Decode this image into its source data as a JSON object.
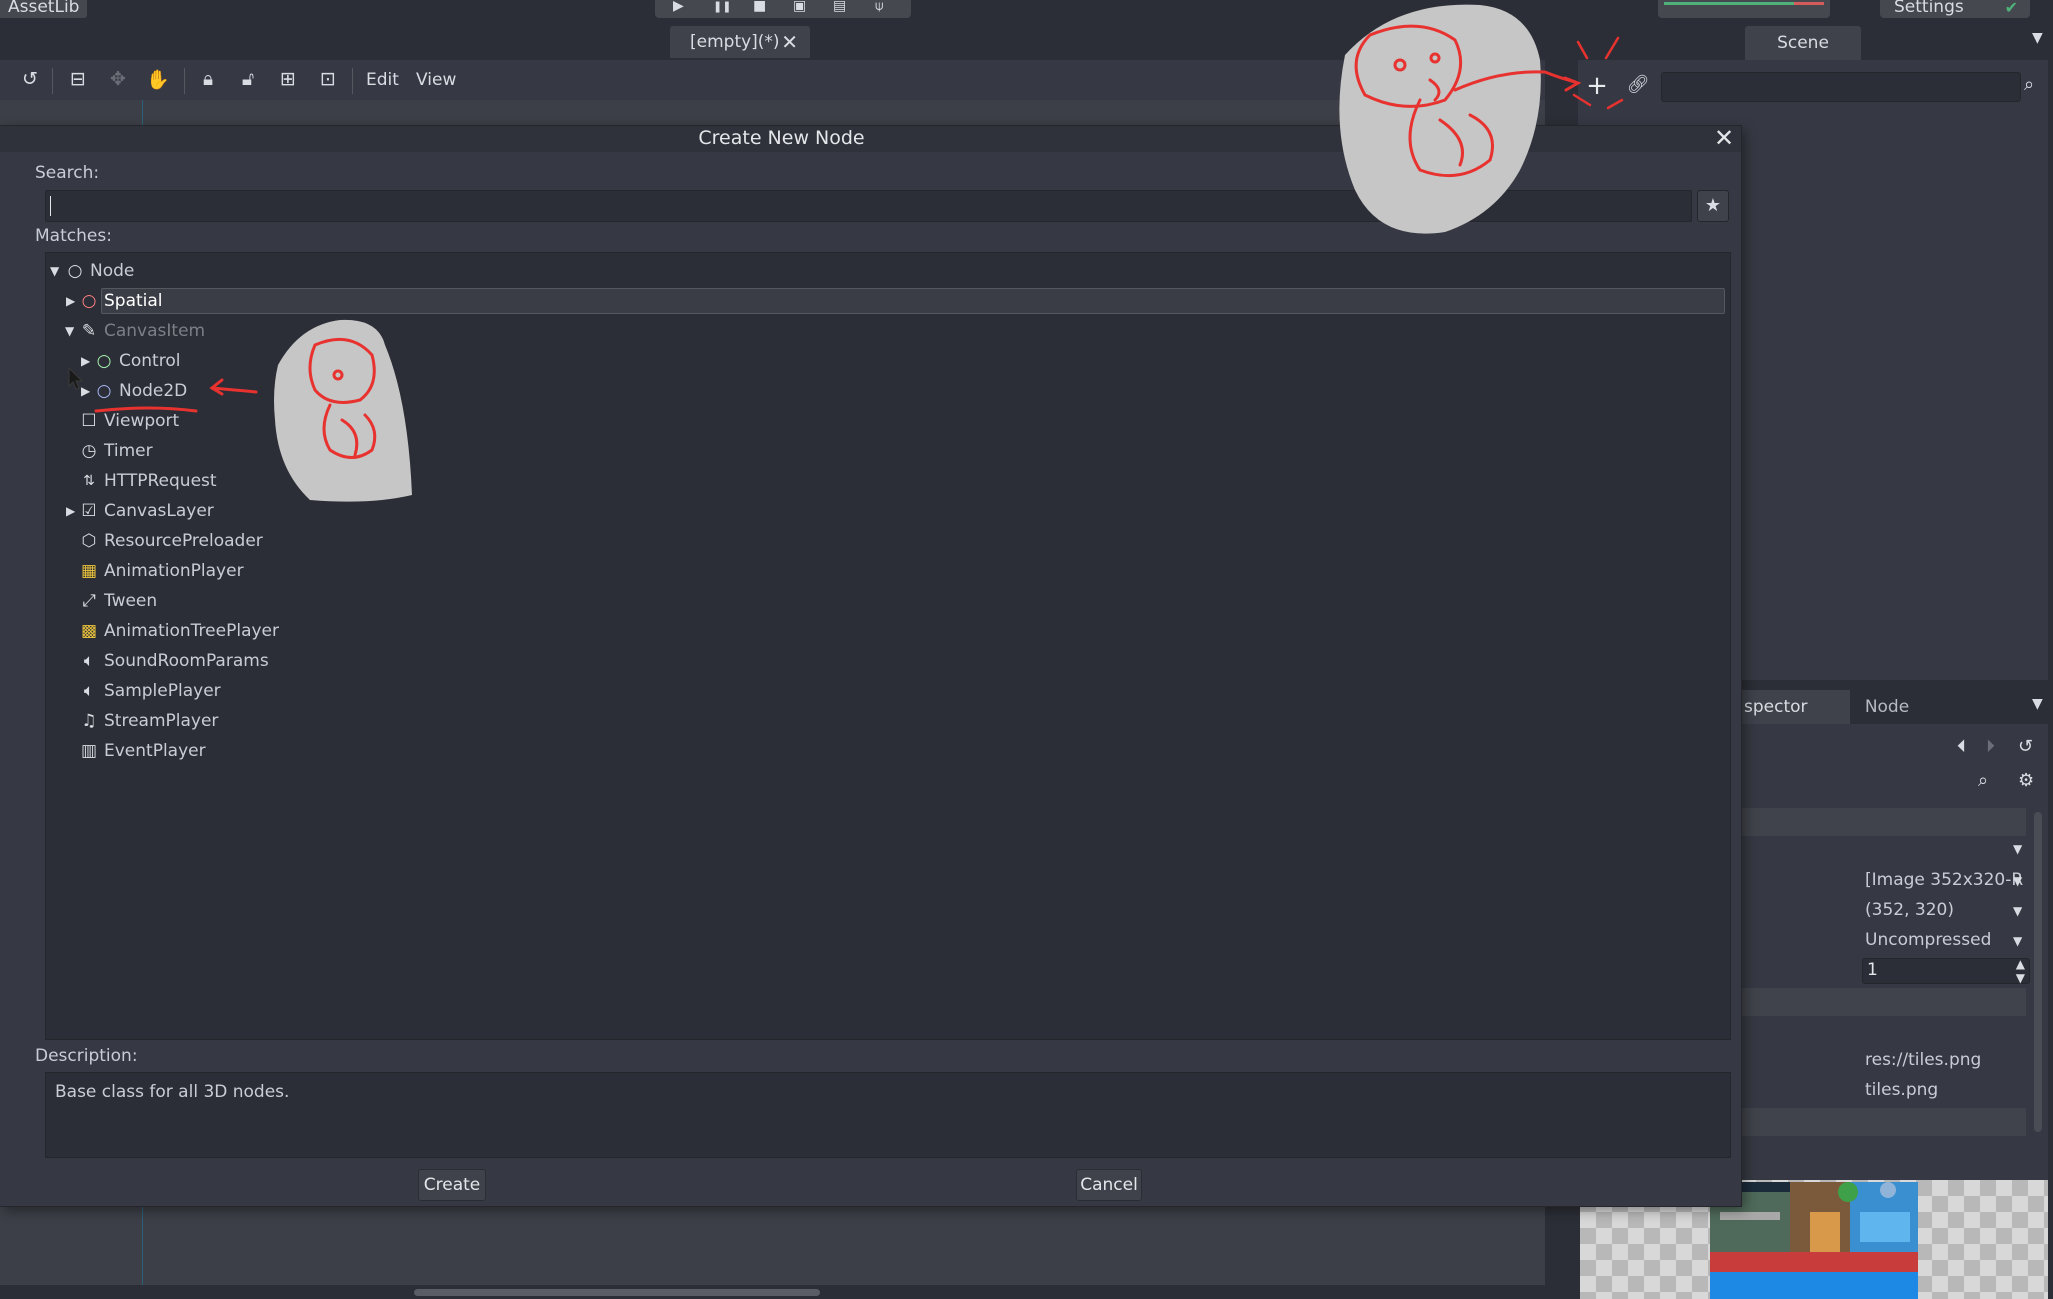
{
  "top": {
    "assetlib_label": "AssetLib",
    "settings_label": "Settings",
    "scene_tab_label": "[empty](*)"
  },
  "toolbar": {
    "edit_menu": "Edit",
    "view_menu": "View"
  },
  "dock": {
    "scene_tab": "Scene",
    "inspector_tab": "spector",
    "node_tab": "Node",
    "inspector_values": {
      "image": "[Image 352x320-R",
      "size": "(352, 320)",
      "storage": "Uncompressed",
      "spin_value": "1",
      "path": "res://tiles.png",
      "name": "tiles.png"
    }
  },
  "dialog": {
    "title": "Create New Node",
    "search_label": "Search:",
    "search_value": "",
    "matches_label": "Matches:",
    "description_label": "Description:",
    "description_text": "Base class for all 3D nodes.",
    "create_button": "Create",
    "cancel_button": "Cancel",
    "tree": [
      {
        "label": "Node",
        "icon": "circle-icon",
        "icon_color": "#d9dce2",
        "expanded": true,
        "dimmed": false
      },
      {
        "label": "Spatial",
        "icon": "circle-icon",
        "icon_color": "#fc7f7f",
        "expanded": false,
        "dimmed": false,
        "selected": true
      },
      {
        "label": "CanvasItem",
        "icon": "pencil-icon",
        "icon_color": "#d9dce2",
        "expanded": true,
        "dimmed": true
      },
      {
        "label": "Control",
        "icon": "circle-icon",
        "icon_color": "#a5efac",
        "expanded": false,
        "dimmed": false
      },
      {
        "label": "Node2D",
        "icon": "circle-icon",
        "icon_color": "#a5b7f3",
        "expanded": false,
        "dimmed": false
      },
      {
        "label": "Viewport",
        "icon": "square-icon",
        "icon_color": "#d9dce2",
        "dimmed": false
      },
      {
        "label": "Timer",
        "icon": "clock-icon",
        "icon_color": "#d9dce2",
        "dimmed": false
      },
      {
        "label": "HTTPRequest",
        "icon": "http-icon",
        "icon_color": "#d9dce2",
        "dimmed": false
      },
      {
        "label": "CanvasLayer",
        "icon": "canvas-layer-icon",
        "icon_color": "#d9dce2",
        "expanded": false,
        "dimmed": false
      },
      {
        "label": "ResourcePreloader",
        "icon": "cube-icon",
        "icon_color": "#d9dce2",
        "dimmed": false
      },
      {
        "label": "AnimationPlayer",
        "icon": "film-icon",
        "icon_color": "#e9c23c",
        "dimmed": false
      },
      {
        "label": "Tween",
        "icon": "tween-icon",
        "icon_color": "#d9dce2",
        "dimmed": false
      },
      {
        "label": "AnimationTreePlayer",
        "icon": "anim-tree-icon",
        "icon_color": "#e9c23c",
        "dimmed": false
      },
      {
        "label": "SoundRoomParams",
        "icon": "speaker-icon",
        "icon_color": "#d9dce2",
        "dimmed": false
      },
      {
        "label": "SamplePlayer",
        "icon": "speaker-icon",
        "icon_color": "#d9dce2",
        "dimmed": false
      },
      {
        "label": "StreamPlayer",
        "icon": "music-note-icon",
        "icon_color": "#d9dce2",
        "dimmed": false
      },
      {
        "label": "EventPlayer",
        "icon": "piano-icon",
        "icon_color": "#d9dce2",
        "dimmed": false
      }
    ]
  },
  "colors": {
    "accent_red_annotation": "#e8322f",
    "panel_bg": "#363943",
    "field_bg": "#2b2e36"
  }
}
